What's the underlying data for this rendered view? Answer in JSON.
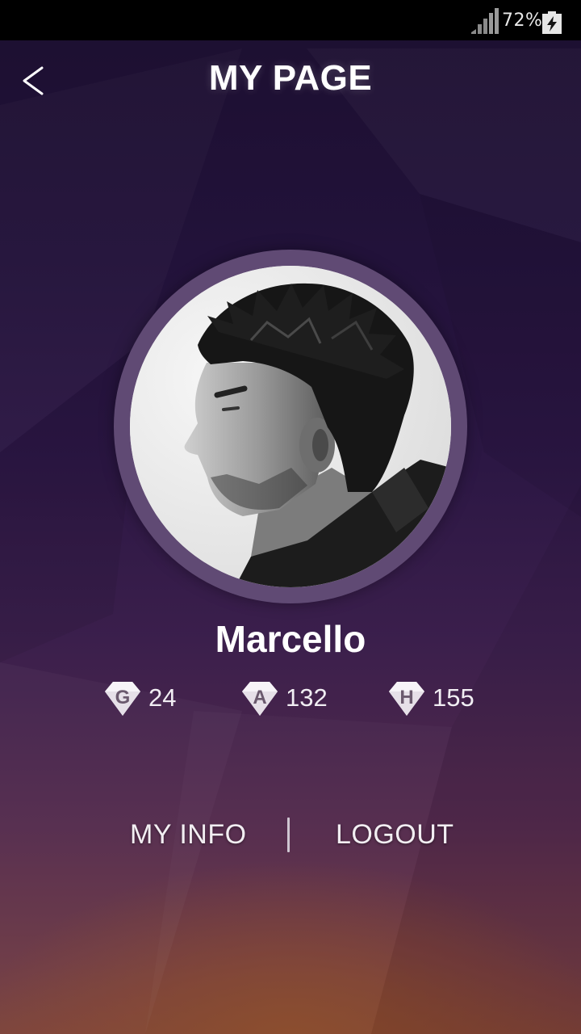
{
  "status_bar": {
    "battery_percent": "72%",
    "signal_icon": "cellular-signal-icon",
    "battery_icon": "battery-charging-icon"
  },
  "header": {
    "back_icon": "chevron-left-icon",
    "title": "MY PAGE"
  },
  "profile": {
    "name": "Marcello",
    "avatar": "profile-photo"
  },
  "stats": [
    {
      "letter": "G",
      "value": "24",
      "icon": "gem-g-icon"
    },
    {
      "letter": "A",
      "value": "132",
      "icon": "gem-a-icon"
    },
    {
      "letter": "H",
      "value": "155",
      "icon": "gem-h-icon"
    }
  ],
  "menu": {
    "my_info": "MY INFO",
    "logout": "LOGOUT"
  },
  "colors": {
    "top_background": "#1c0f30",
    "bottom_glow": "#8a4a2a",
    "avatar_ring": "#604a74",
    "text": "#ffffff"
  }
}
